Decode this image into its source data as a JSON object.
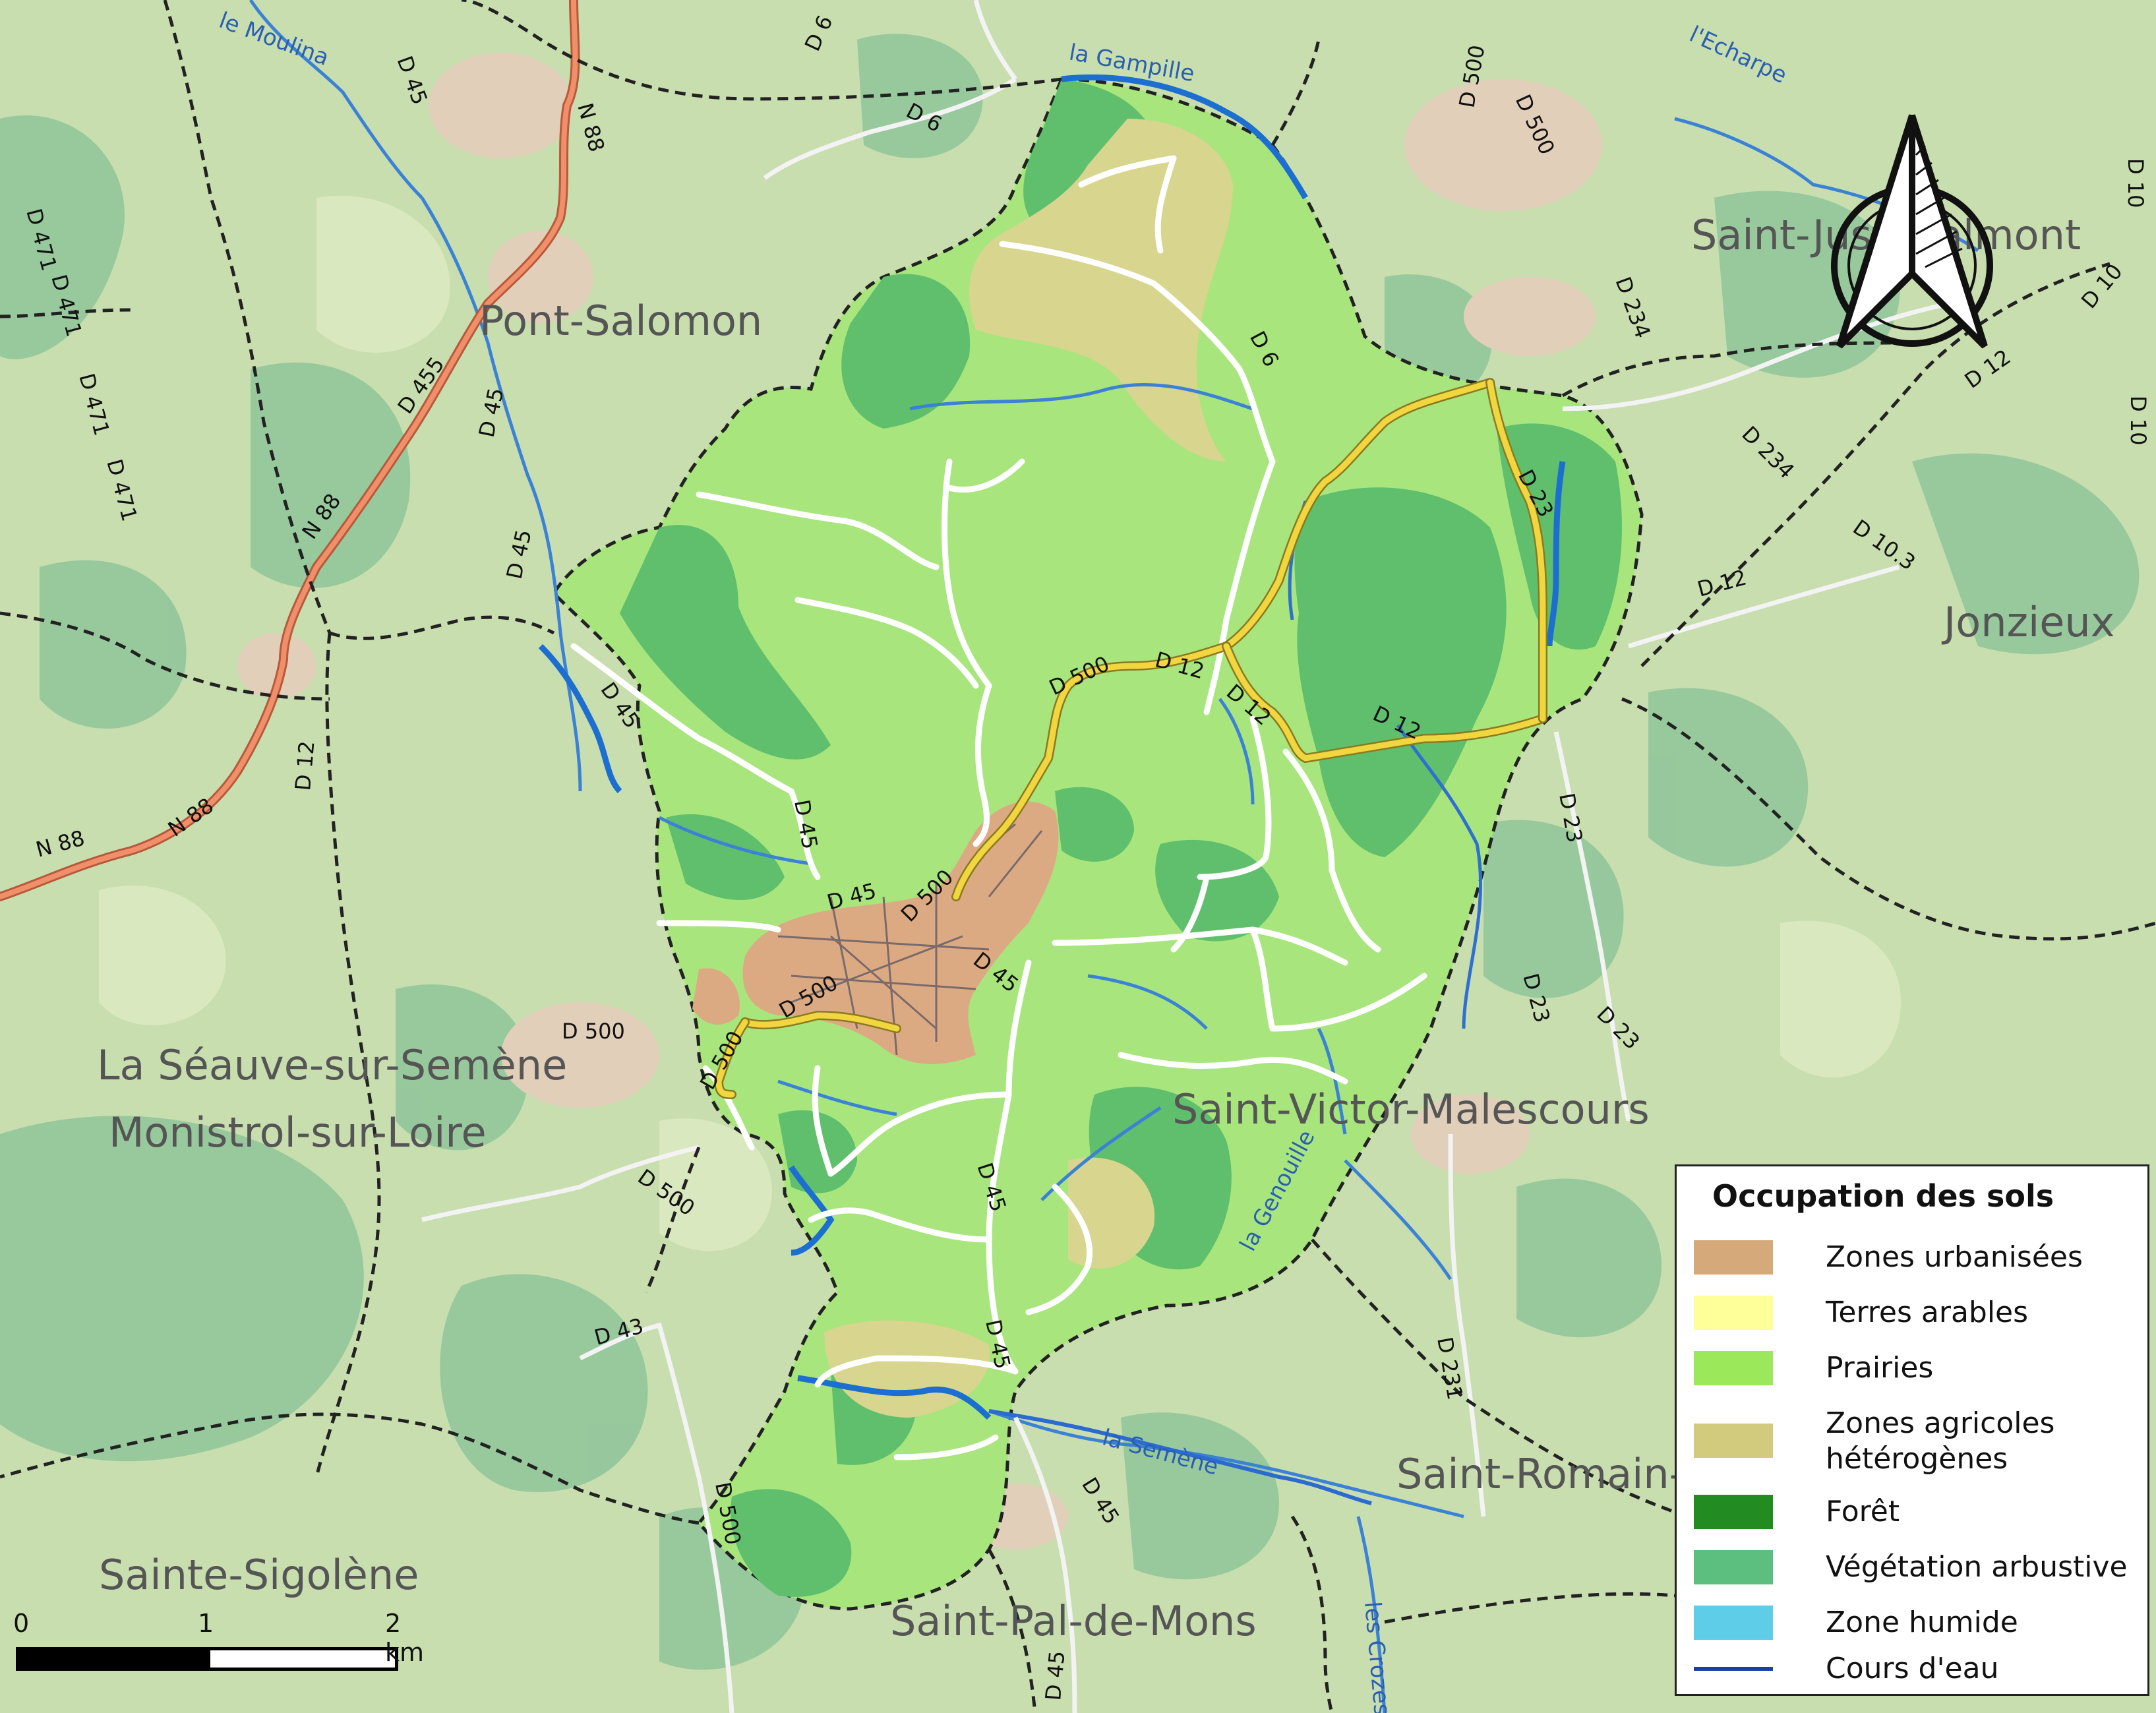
{
  "legend": {
    "title": "Occupation des sols",
    "items": [
      {
        "label": "Zones urbanisées",
        "color": "#d6a97a"
      },
      {
        "label": "Terres arables",
        "color": "#ffff99"
      },
      {
        "label": "Prairies",
        "color": "#9be85a"
      },
      {
        "label": "Zones agricoles hétérogènes",
        "label_lines": [
          "Zones agricoles",
          "hétérogènes"
        ],
        "color": "#d2cb7e"
      },
      {
        "label": "Forêt",
        "color": "#228b22"
      },
      {
        "label": "Végétation arbustive",
        "color": "#5cbf7f"
      },
      {
        "label": "Zone humide",
        "color": "#5ecde8"
      },
      {
        "label": "Cours d'eau",
        "color": "#1c3fa6",
        "kind": "line"
      }
    ]
  },
  "scale": {
    "ticks": [
      "0",
      "1",
      "2 km"
    ]
  },
  "places": {
    "pont_salomon": "Pont-Salomon",
    "saint_just": "Saint-Just-Malmont",
    "jonzieux": "Jonzieux",
    "la_seauve": "La Séauve-sur-Semène",
    "monistrol": "Monistrol-sur-Loire",
    "saint_victor": "Saint-Victor-Malescours",
    "saint_romain": "Saint-Romain-",
    "sainte_sigolene": "Sainte-Sigolène",
    "saint_pal": "Saint-Pal-de-Mons"
  },
  "waterways": {
    "moulina": "le Moulina",
    "gampille": "la Gampille",
    "echarpe": "l'Echarpe",
    "semene": "la Semène",
    "genouille": "la Genouille",
    "crozes": "les Crozes"
  },
  "roads": {
    "d6": "D 6",
    "d45": "D 45",
    "d500": "D 500",
    "n88": "N 88",
    "d455": "D 455",
    "d471": "D 471",
    "d12": "D 12",
    "d23": "D 23",
    "d234": "D 234",
    "d10": "D 10",
    "d10_3": "D 10.3",
    "d43": "D 43",
    "d231": "D 231"
  }
}
